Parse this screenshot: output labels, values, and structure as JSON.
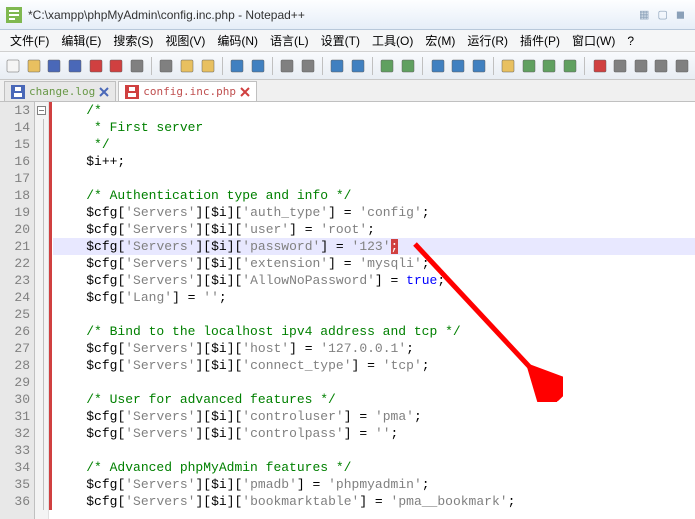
{
  "title": "*C:\\xampp\\phpMyAdmin\\config.inc.php - Notepad++",
  "menu": [
    "文件(F)",
    "编辑(E)",
    "搜索(S)",
    "视图(V)",
    "编码(N)",
    "语言(L)",
    "设置(T)",
    "工具(O)",
    "宏(M)",
    "运行(R)",
    "插件(P)",
    "窗口(W)",
    "?"
  ],
  "tabs": [
    {
      "name": "change.log",
      "active": false,
      "close": "blue"
    },
    {
      "name": "config.inc.php",
      "active": true,
      "close": "red"
    }
  ],
  "lines": {
    "start": 13,
    "rows": [
      {
        "n": 13,
        "fold": "box",
        "t": [
          {
            "c": "c-comment",
            "s": "/*"
          }
        ],
        "ind": 1
      },
      {
        "n": 14,
        "t": [
          {
            "c": "c-comment",
            "s": " * First server"
          }
        ],
        "ind": 1
      },
      {
        "n": 15,
        "t": [
          {
            "c": "c-comment",
            "s": " */"
          }
        ],
        "ind": 1
      },
      {
        "n": 16,
        "t": [
          {
            "c": "c-var",
            "s": "$i"
          },
          {
            "c": "c-op",
            "s": "++;"
          }
        ],
        "ind": 1
      },
      {
        "n": 17,
        "t": [],
        "ind": 1
      },
      {
        "n": 18,
        "t": [
          {
            "c": "c-comment",
            "s": "/* Authentication type and info */"
          }
        ],
        "ind": 1
      },
      {
        "n": 19,
        "t": [
          {
            "c": "c-var",
            "s": "$cfg"
          },
          {
            "c": "c-op",
            "s": "["
          },
          {
            "c": "c-str",
            "s": "'Servers'"
          },
          {
            "c": "c-op",
            "s": "]["
          },
          {
            "c": "c-var",
            "s": "$i"
          },
          {
            "c": "c-op",
            "s": "]["
          },
          {
            "c": "c-str",
            "s": "'auth_type'"
          },
          {
            "c": "c-op",
            "s": "] = "
          },
          {
            "c": "c-str",
            "s": "'config'"
          },
          {
            "c": "c-op",
            "s": ";"
          }
        ],
        "ind": 1
      },
      {
        "n": 20,
        "t": [
          {
            "c": "c-var",
            "s": "$cfg"
          },
          {
            "c": "c-op",
            "s": "["
          },
          {
            "c": "c-str",
            "s": "'Servers'"
          },
          {
            "c": "c-op",
            "s": "]["
          },
          {
            "c": "c-var",
            "s": "$i"
          },
          {
            "c": "c-op",
            "s": "]["
          },
          {
            "c": "c-str",
            "s": "'user'"
          },
          {
            "c": "c-op",
            "s": "] = "
          },
          {
            "c": "c-str",
            "s": "'root'"
          },
          {
            "c": "c-op",
            "s": ";"
          }
        ],
        "ind": 1
      },
      {
        "n": 21,
        "hl": true,
        "t": [
          {
            "c": "c-var",
            "s": "$cfg"
          },
          {
            "c": "c-op",
            "s": "["
          },
          {
            "c": "c-str",
            "s": "'Servers'"
          },
          {
            "c": "c-op",
            "s": "]["
          },
          {
            "c": "c-var",
            "s": "$i"
          },
          {
            "c": "c-op",
            "s": "]["
          },
          {
            "c": "c-str",
            "s": "'password'"
          },
          {
            "c": "c-op",
            "s": "] = "
          },
          {
            "c": "c-str",
            "s": "'123'"
          },
          {
            "c": "c-bracket-hl",
            "s": ";"
          }
        ],
        "ind": 1
      },
      {
        "n": 22,
        "t": [
          {
            "c": "c-var",
            "s": "$cfg"
          },
          {
            "c": "c-op",
            "s": "["
          },
          {
            "c": "c-str",
            "s": "'Servers'"
          },
          {
            "c": "c-op",
            "s": "]["
          },
          {
            "c": "c-var",
            "s": "$i"
          },
          {
            "c": "c-op",
            "s": "]["
          },
          {
            "c": "c-str",
            "s": "'extension'"
          },
          {
            "c": "c-op",
            "s": "] = "
          },
          {
            "c": "c-str",
            "s": "'mysqli'"
          },
          {
            "c": "c-op",
            "s": ";"
          }
        ],
        "ind": 1
      },
      {
        "n": 23,
        "t": [
          {
            "c": "c-var",
            "s": "$cfg"
          },
          {
            "c": "c-op",
            "s": "["
          },
          {
            "c": "c-str",
            "s": "'Servers'"
          },
          {
            "c": "c-op",
            "s": "]["
          },
          {
            "c": "c-var",
            "s": "$i"
          },
          {
            "c": "c-op",
            "s": "]["
          },
          {
            "c": "c-str",
            "s": "'AllowNoPassword'"
          },
          {
            "c": "c-op",
            "s": "] = "
          },
          {
            "c": "c-kw",
            "s": "true"
          },
          {
            "c": "c-op",
            "s": ";"
          }
        ],
        "ind": 1
      },
      {
        "n": 24,
        "t": [
          {
            "c": "c-var",
            "s": "$cfg"
          },
          {
            "c": "c-op",
            "s": "["
          },
          {
            "c": "c-str",
            "s": "'Lang'"
          },
          {
            "c": "c-op",
            "s": "] = "
          },
          {
            "c": "c-str",
            "s": "''"
          },
          {
            "c": "c-op",
            "s": ";"
          }
        ],
        "ind": 1
      },
      {
        "n": 25,
        "t": [],
        "ind": 1
      },
      {
        "n": 26,
        "t": [
          {
            "c": "c-comment",
            "s": "/* Bind to the localhost ipv4 address and tcp */"
          }
        ],
        "ind": 1
      },
      {
        "n": 27,
        "t": [
          {
            "c": "c-var",
            "s": "$cfg"
          },
          {
            "c": "c-op",
            "s": "["
          },
          {
            "c": "c-str",
            "s": "'Servers'"
          },
          {
            "c": "c-op",
            "s": "]["
          },
          {
            "c": "c-var",
            "s": "$i"
          },
          {
            "c": "c-op",
            "s": "]["
          },
          {
            "c": "c-str",
            "s": "'host'"
          },
          {
            "c": "c-op",
            "s": "] = "
          },
          {
            "c": "c-str",
            "s": "'127.0.0.1'"
          },
          {
            "c": "c-op",
            "s": ";"
          }
        ],
        "ind": 1
      },
      {
        "n": 28,
        "t": [
          {
            "c": "c-var",
            "s": "$cfg"
          },
          {
            "c": "c-op",
            "s": "["
          },
          {
            "c": "c-str",
            "s": "'Servers'"
          },
          {
            "c": "c-op",
            "s": "]["
          },
          {
            "c": "c-var",
            "s": "$i"
          },
          {
            "c": "c-op",
            "s": "]["
          },
          {
            "c": "c-str",
            "s": "'connect_type'"
          },
          {
            "c": "c-op",
            "s": "] = "
          },
          {
            "c": "c-str",
            "s": "'tcp'"
          },
          {
            "c": "c-op",
            "s": ";"
          }
        ],
        "ind": 1
      },
      {
        "n": 29,
        "t": [],
        "ind": 1
      },
      {
        "n": 30,
        "t": [
          {
            "c": "c-comment",
            "s": "/* User for advanced features */"
          }
        ],
        "ind": 1
      },
      {
        "n": 31,
        "t": [
          {
            "c": "c-var",
            "s": "$cfg"
          },
          {
            "c": "c-op",
            "s": "["
          },
          {
            "c": "c-str",
            "s": "'Servers'"
          },
          {
            "c": "c-op",
            "s": "]["
          },
          {
            "c": "c-var",
            "s": "$i"
          },
          {
            "c": "c-op",
            "s": "]["
          },
          {
            "c": "c-str",
            "s": "'controluser'"
          },
          {
            "c": "c-op",
            "s": "] = "
          },
          {
            "c": "c-str",
            "s": "'pma'"
          },
          {
            "c": "c-op",
            "s": ";"
          }
        ],
        "ind": 1
      },
      {
        "n": 32,
        "t": [
          {
            "c": "c-var",
            "s": "$cfg"
          },
          {
            "c": "c-op",
            "s": "["
          },
          {
            "c": "c-str",
            "s": "'Servers'"
          },
          {
            "c": "c-op",
            "s": "]["
          },
          {
            "c": "c-var",
            "s": "$i"
          },
          {
            "c": "c-op",
            "s": "]["
          },
          {
            "c": "c-str",
            "s": "'controlpass'"
          },
          {
            "c": "c-op",
            "s": "] = "
          },
          {
            "c": "c-str",
            "s": "''"
          },
          {
            "c": "c-op",
            "s": ";"
          }
        ],
        "ind": 1
      },
      {
        "n": 33,
        "t": [],
        "ind": 1
      },
      {
        "n": 34,
        "t": [
          {
            "c": "c-comment",
            "s": "/* Advanced phpMyAdmin features */"
          }
        ],
        "ind": 1
      },
      {
        "n": 35,
        "t": [
          {
            "c": "c-var",
            "s": "$cfg"
          },
          {
            "c": "c-op",
            "s": "["
          },
          {
            "c": "c-str",
            "s": "'Servers'"
          },
          {
            "c": "c-op",
            "s": "]["
          },
          {
            "c": "c-var",
            "s": "$i"
          },
          {
            "c": "c-op",
            "s": "]["
          },
          {
            "c": "c-str",
            "s": "'pmadb'"
          },
          {
            "c": "c-op",
            "s": "] = "
          },
          {
            "c": "c-str",
            "s": "'phpmyadmin'"
          },
          {
            "c": "c-op",
            "s": ";"
          }
        ],
        "ind": 1
      },
      {
        "n": 36,
        "t": [
          {
            "c": "c-var",
            "s": "$cfg"
          },
          {
            "c": "c-op",
            "s": "["
          },
          {
            "c": "c-str",
            "s": "'Servers'"
          },
          {
            "c": "c-op",
            "s": "]["
          },
          {
            "c": "c-var",
            "s": "$i"
          },
          {
            "c": "c-op",
            "s": "]["
          },
          {
            "c": "c-str",
            "s": "'bookmarktable'"
          },
          {
            "c": "c-op",
            "s": "] = "
          },
          {
            "c": "c-str",
            "s": "'pma__bookmark'"
          },
          {
            "c": "c-op",
            "s": ";"
          }
        ],
        "ind": 1
      }
    ]
  },
  "toolbar_icons": [
    {
      "n": "new-file-icon",
      "c": "#f5f5f5"
    },
    {
      "n": "open-icon",
      "c": "#e8c060"
    },
    {
      "n": "save-icon",
      "c": "#4a68b8"
    },
    {
      "n": "save-all-icon",
      "c": "#4a68b8"
    },
    {
      "n": "close-icon",
      "c": "#d04040"
    },
    {
      "n": "close-all-icon",
      "c": "#d04040"
    },
    {
      "n": "print-icon",
      "c": "#808080"
    },
    "sep",
    {
      "n": "cut-icon",
      "c": "#808080"
    },
    {
      "n": "copy-icon",
      "c": "#e8c060"
    },
    {
      "n": "paste-icon",
      "c": "#e8c060"
    },
    "sep",
    {
      "n": "undo-icon",
      "c": "#4080c0"
    },
    {
      "n": "redo-icon",
      "c": "#4080c0"
    },
    "sep",
    {
      "n": "find-icon",
      "c": "#808080"
    },
    {
      "n": "replace-icon",
      "c": "#808080"
    },
    "sep",
    {
      "n": "zoom-in-icon",
      "c": "#4080c0"
    },
    {
      "n": "zoom-out-icon",
      "c": "#4080c0"
    },
    "sep",
    {
      "n": "sync-v-icon",
      "c": "#60a060"
    },
    {
      "n": "sync-h-icon",
      "c": "#60a060"
    },
    "sep",
    {
      "n": "wrap-icon",
      "c": "#4080c0"
    },
    {
      "n": "show-all-icon",
      "c": "#4080c0"
    },
    {
      "n": "indent-icon",
      "c": "#4080c0"
    },
    "sep",
    {
      "n": "folder-icon",
      "c": "#e8c060"
    },
    {
      "n": "doc-map-icon",
      "c": "#60a060"
    },
    {
      "n": "func-list-icon",
      "c": "#60a060"
    },
    {
      "n": "doc-list-icon",
      "c": "#60a060"
    },
    "sep",
    {
      "n": "macro-rec-icon",
      "c": "#d04040"
    },
    {
      "n": "macro-stop-icon",
      "c": "#808080"
    },
    {
      "n": "macro-play-icon",
      "c": "#808080"
    },
    {
      "n": "macro-multi-icon",
      "c": "#808080"
    },
    {
      "n": "macro-save-icon",
      "c": "#808080"
    }
  ]
}
